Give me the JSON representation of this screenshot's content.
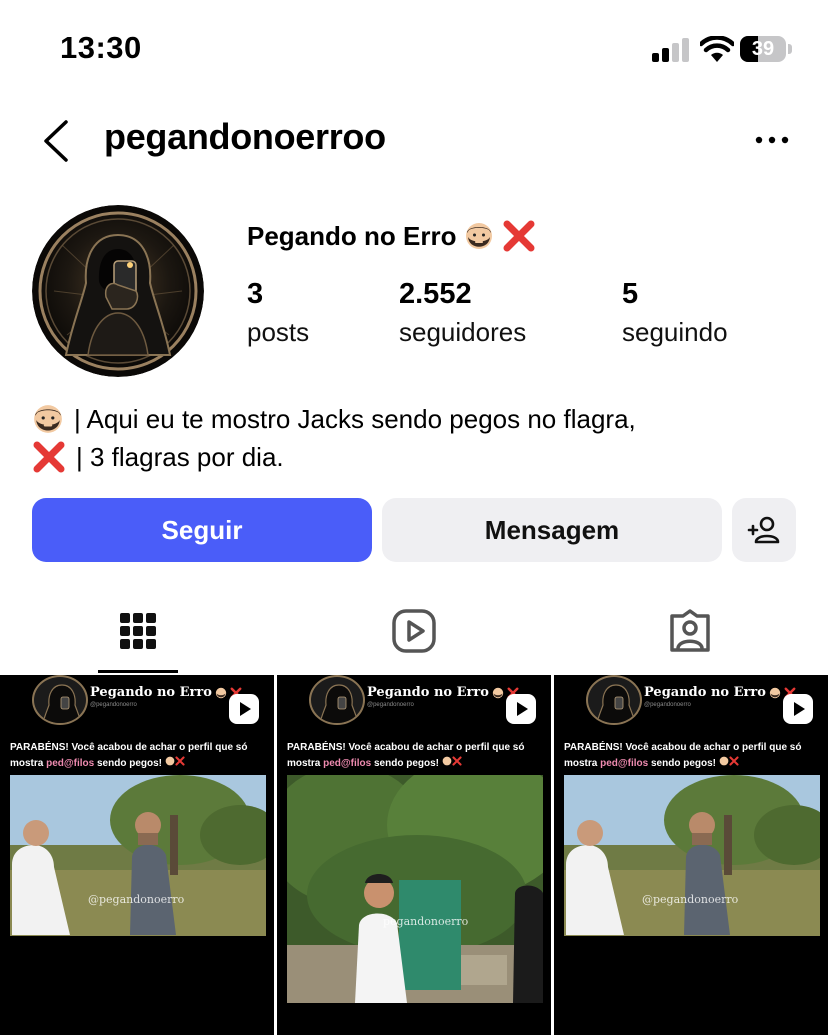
{
  "status_bar": {
    "time": "13:30",
    "battery_level": "39",
    "battery_fraction": 0.39
  },
  "header": {
    "username": "pegandonoerroo"
  },
  "profile": {
    "display_name": "Pegando no Erro",
    "name_emojis": [
      "beard-man-icon",
      "red-x-icon"
    ],
    "stats": [
      {
        "value": "3",
        "label": "posts"
      },
      {
        "value": "2.552",
        "label": "seguidores"
      },
      {
        "value": "5",
        "label": "seguindo"
      }
    ],
    "bio_lines": [
      {
        "icon": "beard-man-icon",
        "text": "| Aqui eu te mostro Jacks sendo pegos no flagra,"
      },
      {
        "icon": "red-x-icon",
        "text": "| 3 flagras por dia."
      }
    ]
  },
  "actions": {
    "follow_label": "Seguir",
    "message_label": "Mensagem",
    "add_icon": "add-person-icon"
  },
  "tabs": [
    {
      "icon": "grid-icon",
      "active": true
    },
    {
      "icon": "reels-icon",
      "active": false
    },
    {
      "icon": "tagged-icon",
      "active": false
    }
  ],
  "posts": [
    {
      "brand": "Pegando no Erro",
      "handle": "@pegandonoerro",
      "caption_start": "PARABÉNS! Você acabou de achar o perfil que só mostra ",
      "caption_highlight": "ped@filos",
      "caption_end": " sendo pegos!",
      "watermark": "@pegandonoerro",
      "type_icon": "reel-play-icon"
    },
    {
      "brand": "Pegando no Erro",
      "handle": "@pegandonoerro",
      "caption_start": "PARABÉNS! Você acabou de achar o perfil que só mostra ",
      "caption_highlight": "ped@filos",
      "caption_end": " sendo pegos!",
      "watermark": "pegandonoerro",
      "type_icon": "reel-play-icon"
    },
    {
      "brand": "Pegando no Erro",
      "handle": "@pegandonoerro",
      "caption_start": "PARABÉNS! Você acabou de achar o perfil que só mostra ",
      "caption_highlight": "ped@filos",
      "caption_end": " sendo pegos!",
      "watermark": "@pegandonoerro",
      "type_icon": "reel-play-icon"
    }
  ],
  "colors": {
    "follow_button": "#4a5df9",
    "secondary_button": "#efeff2",
    "highlight": "#ef8bb0",
    "red_x": "#e53935"
  }
}
